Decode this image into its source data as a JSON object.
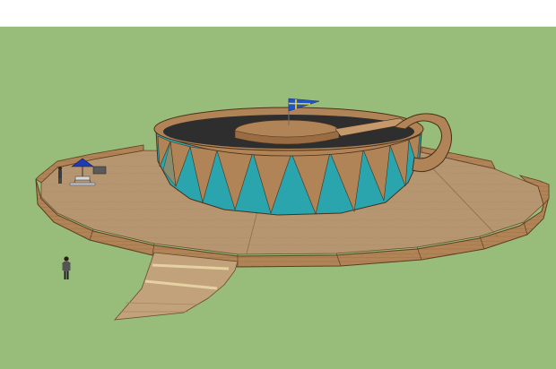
{
  "scene": {
    "title": "",
    "sky_color": "#ffffff",
    "ground_color": "#98bc7a",
    "wood_color": "#b08456",
    "wood_dark_color": "#8a5f38",
    "deck_color": "#b69670",
    "teal_color": "#2aa5ad",
    "interior_color": "#2e2e2e",
    "flag_colors": {
      "field": "#2255c4",
      "cross": "#f5d410"
    },
    "umbrella_color": "#1e3bb0",
    "icons": [
      "cup-model",
      "saucer-deck",
      "ramp",
      "flag",
      "umbrella",
      "human-figure"
    ]
  }
}
